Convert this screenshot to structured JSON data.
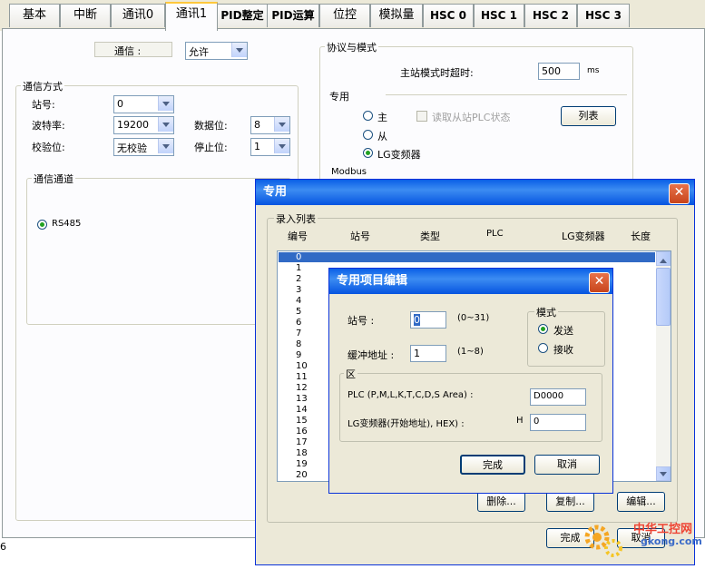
{
  "tabs": [
    "基本",
    "中断",
    "通讯0",
    "通讯1",
    "PID整定",
    "PID运算",
    "位控",
    "模拟量",
    "HSC 0",
    "HSC 1",
    "HSC 2",
    "HSC 3"
  ],
  "comm": {
    "label": "通信 :",
    "value": "允许"
  },
  "comm_mode": {
    "title": "通信方式",
    "station_label": "站号:",
    "station_value": "0",
    "baud_label": "波特率:",
    "baud_value": "19200",
    "databits_label": "数据位:",
    "databits_value": "8",
    "parity_label": "校验位:",
    "parity_value": "无校验",
    "stopbits_label": "停止位:",
    "stopbits_value": "1",
    "channel_title": "通信通道",
    "channel_option": "RS485"
  },
  "protocol": {
    "title": "协议与模式",
    "master_timeout_label": "主站模式时超时:",
    "master_timeout_value": "500",
    "master_timeout_unit": "ms",
    "special_label": "专用",
    "opt_master": "主",
    "opt_slave": "从",
    "opt_lg": "LG变频器",
    "read_slave_status": "读取从站PLC状态",
    "list_button": "列表",
    "modbus_label": "Modbus"
  },
  "dedicated_dialog": {
    "title": "专用",
    "close": "✕",
    "list_group": "录入列表",
    "columns": [
      "编号",
      "站号",
      "类型",
      "PLC",
      "LG变频器",
      "长度"
    ],
    "rows": [
      "0",
      "1",
      "2",
      "3",
      "4",
      "5",
      "6",
      "7",
      "8",
      "9",
      "10",
      "11",
      "12",
      "13",
      "14",
      "15",
      "16",
      "17",
      "18",
      "19",
      "20"
    ],
    "delete_button": "删除...",
    "copy_button": "复制...",
    "edit_button": "编辑...",
    "finish_button": "完成",
    "cancel_button": "取消"
  },
  "edit_dialog": {
    "title": "专用项目编辑",
    "close": "✕",
    "station_label": "站号 :",
    "station_value": "0",
    "station_range": "(0~31)",
    "buffer_label": "缓冲地址 :",
    "buffer_value": "1",
    "buffer_range": "(1~8)",
    "mode_title": "模式",
    "mode_send": "发送",
    "mode_receive": "接收",
    "area_title": "区",
    "plc_label": "PLC (P,M,L,K,T,C,D,S Area) :",
    "plc_value": "D0000",
    "lg_label": "LG变频器(开始地址), HEX) :",
    "lg_prefix": "H",
    "lg_value": "0",
    "finish_button": "完成",
    "cancel_button": "取消"
  },
  "footer_fragment": "6",
  "watermark": {
    "text": "中华工控网",
    "url": "gkong.com"
  }
}
